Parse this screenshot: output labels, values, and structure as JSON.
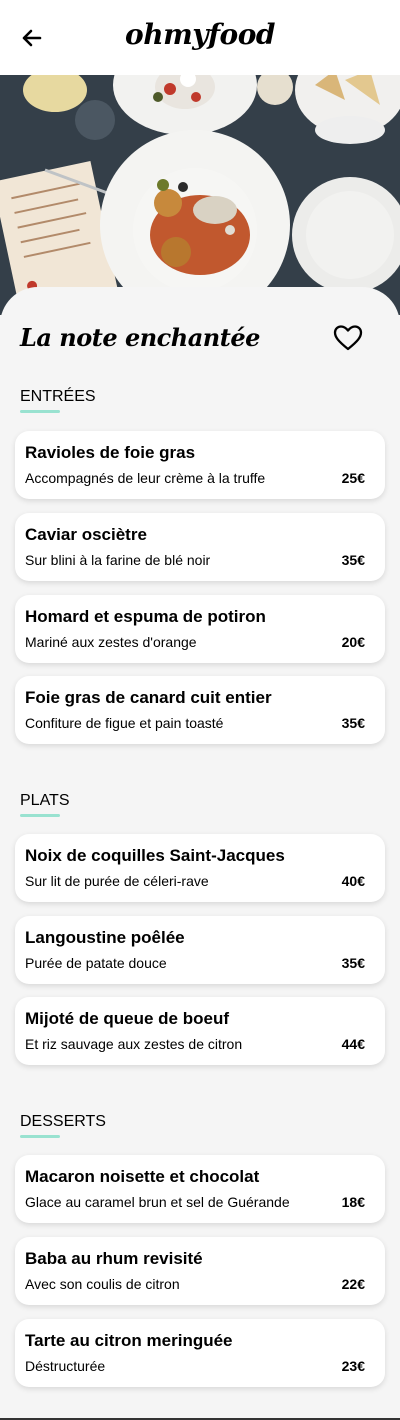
{
  "header": {
    "logo": "ohmyfood"
  },
  "restaurant": {
    "name": "La note enchantée"
  },
  "sections": [
    {
      "title": "ENTRÉES",
      "items": [
        {
          "name": "Ravioles de foie gras",
          "desc": "Accompagnés de leur crème à la truffe",
          "price": "25€"
        },
        {
          "name": "Caviar osciètre",
          "desc": "Sur blini à la farine de blé noir",
          "price": "35€"
        },
        {
          "name": "Homard et espuma de potiron",
          "desc": "Mariné aux zestes d'orange",
          "price": "20€"
        },
        {
          "name": "Foie gras de canard cuit entier",
          "desc": "Confiture de figue et pain toasté",
          "price": "35€"
        }
      ]
    },
    {
      "title": "PLATS",
      "items": [
        {
          "name": "Noix de coquilles Saint-Jacques",
          "desc": "Sur lit de purée de céleri-rave",
          "price": "40€"
        },
        {
          "name": "Langoustine poêlée",
          "desc": "Purée de patate douce",
          "price": "35€"
        },
        {
          "name": "Mijoté de queue de boeuf",
          "desc": "Et riz sauvage aux zestes de citron",
          "price": "44€"
        }
      ]
    },
    {
      "title": "DESSERTS",
      "items": [
        {
          "name": "Macaron noisette et chocolat",
          "desc": "Glace au caramel brun et sel de Guérande",
          "price": "18€"
        },
        {
          "name": "Baba au rhum revisité",
          "desc": "Avec son coulis de citron",
          "price": "22€"
        },
        {
          "name": "Tarte au citron meringuée",
          "desc": "Déstructurée",
          "price": "23€"
        }
      ]
    }
  ],
  "colors": {
    "accent": "#99e2d0",
    "background": "#f5f5f5",
    "card": "#ffffff"
  },
  "icons": {
    "back": "arrow-left-icon",
    "favorite": "heart-outline-icon"
  }
}
